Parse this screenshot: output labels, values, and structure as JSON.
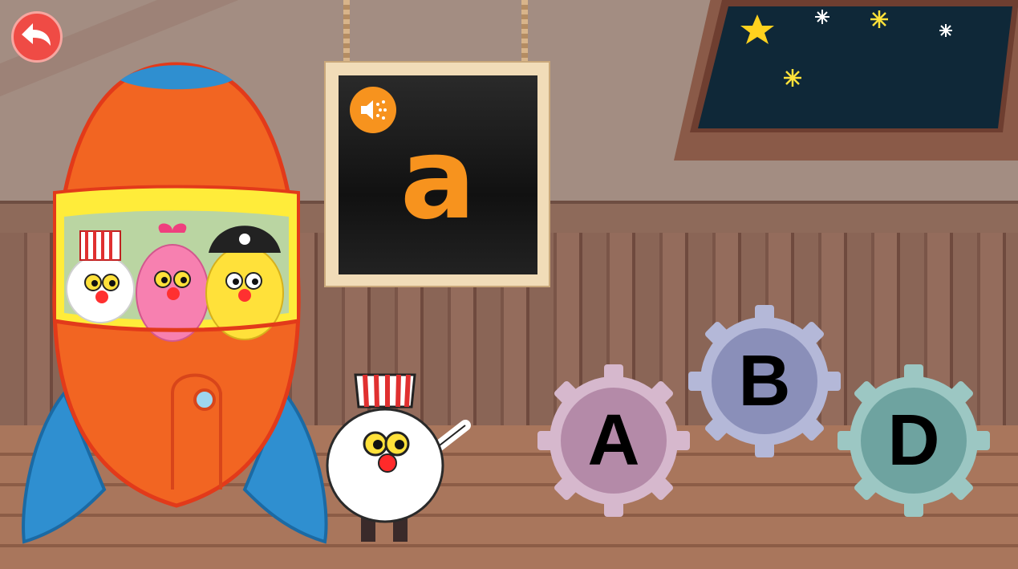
{
  "board": {
    "letter": "a"
  },
  "answers": [
    {
      "label": "A",
      "color": "#b48aa8",
      "rim": "#d6b8cd"
    },
    {
      "label": "B",
      "color": "#8a8fb9",
      "rim": "#b4b8d8"
    },
    {
      "label": "D",
      "color": "#6ea3a0",
      "rim": "#9cc7c3"
    }
  ],
  "colors": {
    "accent": "#f7931e",
    "back": "#ef4b45",
    "rocket": "#f26522",
    "rocket_fin": "#2f8fd0"
  },
  "icons": {
    "back": "back-arrow-icon",
    "sound": "speaker-icon"
  }
}
